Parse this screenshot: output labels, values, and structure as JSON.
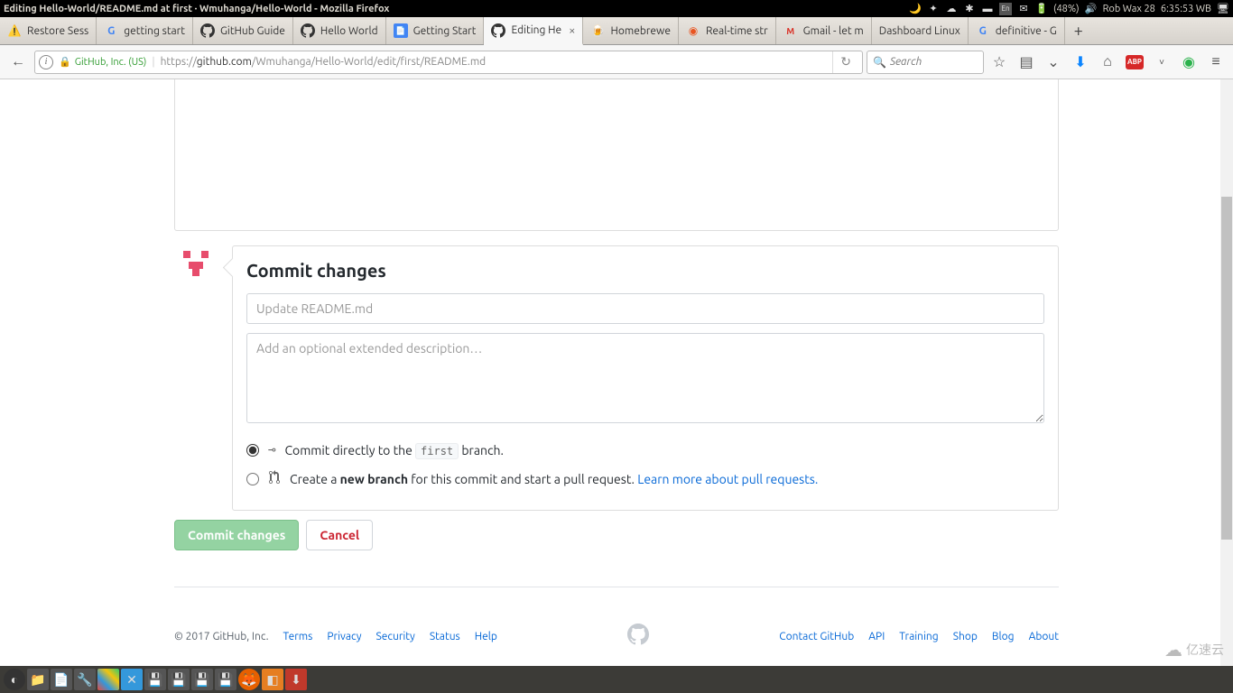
{
  "titlebar": {
    "title": "Editing Hello-World/README.md at first · Wmuhanga/Hello-World - Mozilla Firefox",
    "battery": "(48%)",
    "user": "Rob Wax 28",
    "time": "6:35:53 WB"
  },
  "tabs": [
    {
      "label": "Restore Sess",
      "icon": "⚠"
    },
    {
      "label": "getting start",
      "icon": "G"
    },
    {
      "label": "GitHub Guide",
      "icon": "gh"
    },
    {
      "label": "Hello World",
      "icon": "gh"
    },
    {
      "label": "Getting Start",
      "icon": "doc"
    },
    {
      "label": "Editing He",
      "icon": "gh",
      "active": true,
      "close": true
    },
    {
      "label": "Homebrewe",
      "icon": "hb"
    },
    {
      "label": "Real-time str",
      "icon": "ub"
    },
    {
      "label": "Gmail - let m",
      "icon": "gm"
    },
    {
      "label": "Dashboard Linux",
      "icon": ""
    },
    {
      "label": "definitive - G",
      "icon": "G"
    }
  ],
  "urlbar": {
    "cert": "GitHub, Inc. (US)",
    "prefix": "https://",
    "host": "github.com",
    "path": "/Wmuhanga/Hello-World/edit/first/README.md"
  },
  "search": {
    "placeholder": "Search"
  },
  "commit": {
    "heading": "Commit changes",
    "summary_placeholder": "Update README.md",
    "desc_placeholder": "Add an optional extended description…",
    "direct_pre": "Commit directly to the ",
    "branch": "first",
    "direct_post": " branch.",
    "newbranch_pre": "Create a ",
    "newbranch_bold": "new branch",
    "newbranch_post": " for this commit and start a pull request. ",
    "pr_link": "Learn more about pull requests.",
    "commit_btn": "Commit changes",
    "cancel_btn": "Cancel"
  },
  "footer": {
    "copyright": "© 2017 GitHub, Inc.",
    "left": [
      "Terms",
      "Privacy",
      "Security",
      "Status",
      "Help"
    ],
    "right": [
      "Contact GitHub",
      "API",
      "Training",
      "Shop",
      "Blog",
      "About"
    ]
  },
  "watermark": "亿速云"
}
